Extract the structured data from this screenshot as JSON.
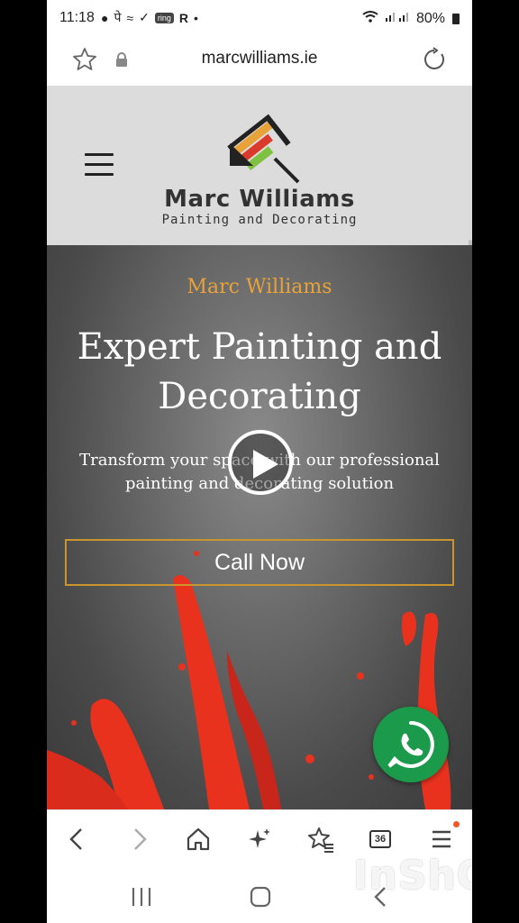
{
  "status_bar": {
    "time": "11:18",
    "ring_label": "ring",
    "r_label": "R",
    "battery": "80%"
  },
  "browser": {
    "url": "marcwilliams.ie",
    "tab_count": "36"
  },
  "site": {
    "logo_name": "Marc Williams",
    "logo_tagline": "Painting and Decorating",
    "logo_colors": [
      "#e8a23a",
      "#d93a2b",
      "#7fc241",
      "#222222"
    ]
  },
  "hero": {
    "eyebrow": "Marc Williams",
    "title": "Expert Painting and Decorating",
    "subtitle": "Transform your space with our professional painting and decorating solution",
    "cta_label": "Call Now",
    "accent_color": "#e8a23a",
    "splash_color": "#e8321e"
  },
  "overlays": {
    "play_icon": "play-icon",
    "whatsapp_icon": "whatsapp-icon",
    "whatsapp_color": "#1a9a4a",
    "watermark": "InShOt"
  },
  "toolbar_icons": [
    "back-arrow-icon",
    "forward-arrow-icon",
    "home-icon",
    "sparkle-icon",
    "bookmarks-icon",
    "tabs-icon",
    "menu-icon"
  ],
  "nav_icons": [
    "recent-apps-icon",
    "home-button-icon",
    "back-icon"
  ]
}
